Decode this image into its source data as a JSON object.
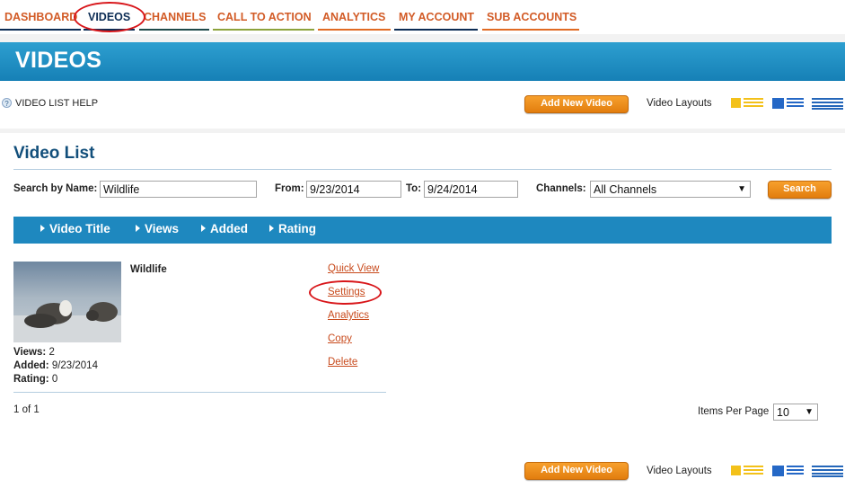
{
  "nav": {
    "tabs": [
      {
        "label": "DASHBOARD",
        "underline": "#0c2c54"
      },
      {
        "label": "VIDEOS",
        "underline": "#0c2c54"
      },
      {
        "label": "CHANNELS",
        "underline": "#1f4a4a"
      },
      {
        "label": "CALL TO ACTION",
        "underline": "#8ca23c"
      },
      {
        "label": "ANALYTICS",
        "underline": "#e06a23"
      },
      {
        "label": "MY ACCOUNT",
        "underline": "#0c2c54"
      },
      {
        "label": "SUB ACCOUNTS",
        "underline": "#e06a23"
      }
    ],
    "active": "VIDEOS"
  },
  "banner": {
    "title": "VIDEOS"
  },
  "toolbar": {
    "help_icon": "question-icon",
    "help_label": "VIDEO LIST HELP",
    "add_button": "Add New Video",
    "layouts_label": "Video Layouts"
  },
  "list": {
    "title": "Video List",
    "search_label": "Search by Name:",
    "search_value": "Wildlife",
    "from_label": "From:",
    "from_value": "9/23/2014",
    "to_label": "To:",
    "to_value": "9/24/2014",
    "channels_label": "Channels:",
    "channels_value": "All Channels",
    "search_button": "Search",
    "columns": [
      "Video Title",
      "Views",
      "Added",
      "Rating"
    ]
  },
  "video": {
    "title": "Wildlife",
    "views_label": "Views:",
    "views": "2",
    "added_label": "Added:",
    "added": "9/23/2014",
    "rating_label": "Rating:",
    "rating": "0",
    "actions": [
      "Quick View",
      "Settings",
      "Analytics",
      "Copy",
      "Delete"
    ]
  },
  "pager": {
    "text": "1 of 1",
    "ipp_label": "Items Per Page",
    "ipp_value": "10"
  },
  "bottom": {
    "add_button": "Add New Video",
    "layouts_label": "Video Layouts"
  },
  "colors": {
    "accent_orange": "#d25b26",
    "header_blue": "#1e88bf",
    "title_blue": "#124f7b",
    "highlight_red": "#d8161a"
  }
}
